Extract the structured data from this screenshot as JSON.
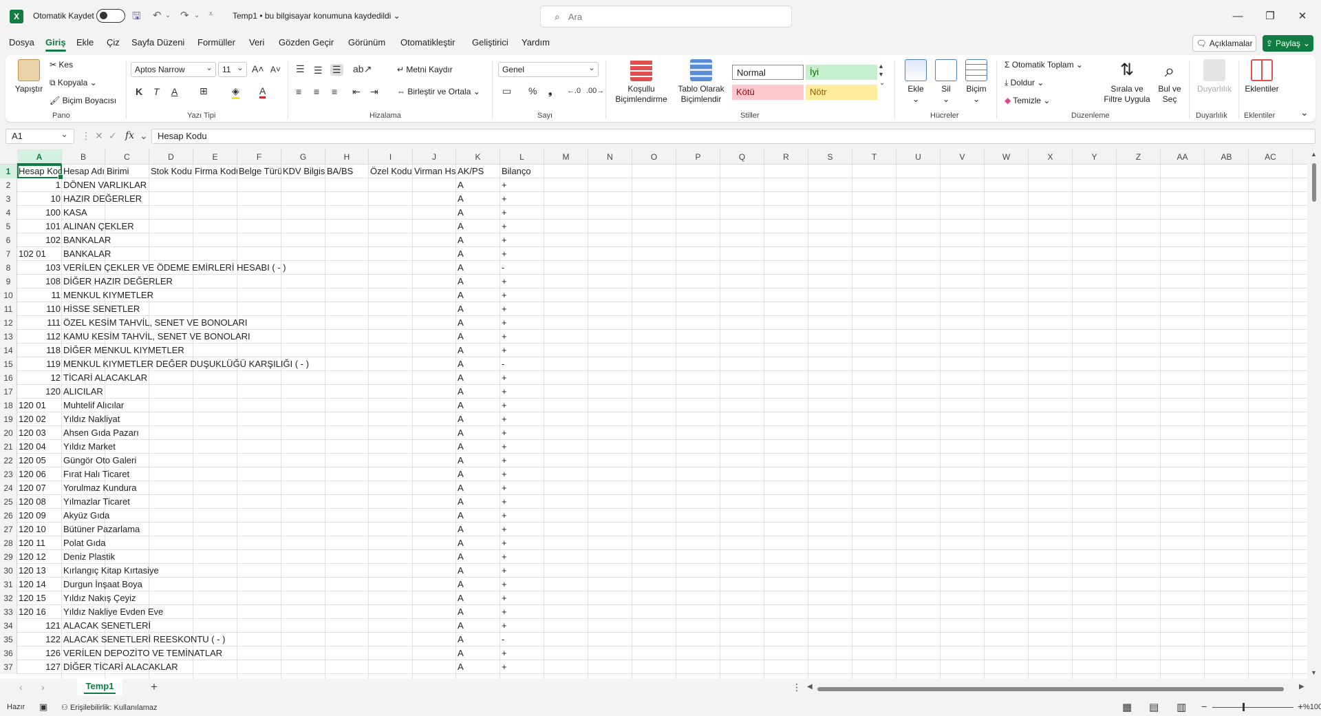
{
  "titlebar": {
    "autosave_label": "Otomatik Kaydet",
    "doc_title": "Temp1 • bu bilgisayar konumuna kaydedildi ⌄",
    "search_placeholder": "Ara"
  },
  "menu": [
    "Dosya",
    "Giriş",
    "Ekle",
    "Çiz",
    "Sayfa Düzeni",
    "Formüller",
    "Veri",
    "Gözden Geçir",
    "Görünüm",
    "Otomatikleştir",
    "Geliştirici",
    "Yardım"
  ],
  "actions": {
    "comments": "Açıklamalar",
    "share": "Paylaş"
  },
  "ribbon": {
    "pano": {
      "label": "Pano",
      "paste": "Yapıştır",
      "cut": "Kes",
      "copy": "Kopyala",
      "format_painter": "Biçim Boyacısı"
    },
    "font": {
      "label": "Yazı Tipi",
      "name": "Aptos Narrow",
      "size": "11",
      "bold": "K",
      "italic": "T",
      "underline": "A"
    },
    "alignment": {
      "label": "Hizalama",
      "wrap": "Metni Kaydır",
      "merge": "Birleştir ve Ortala"
    },
    "number": {
      "label": "Sayı",
      "format": "Genel"
    },
    "styles": {
      "label": "Stiller",
      "conditional": "Koşullu Biçimlendirme",
      "table": "Tablo Olarak Biçimlendir",
      "normal": "Normal",
      "good": "İyi",
      "bad": "Kötü",
      "neutral": "Nötr"
    },
    "cells": {
      "label": "Hücreler",
      "insert": "Ekle",
      "delete": "Sil",
      "format": "Biçim"
    },
    "editing": {
      "label": "Düzenleme",
      "autosum": "Otomatik Toplam",
      "fill": "Doldur",
      "clear": "Temizle",
      "sort": "Sırala ve Filtre Uygula",
      "find": "Bul ve Seç"
    },
    "sensitivity": {
      "label": "Duyarlılık",
      "btn": "Duyarlılık"
    },
    "addins": {
      "label": "Eklentiler",
      "btn": "Eklentiler"
    }
  },
  "formula_bar": {
    "namebox": "A1",
    "fx": "fx",
    "content": "Hesap Kodu"
  },
  "columns": [
    "A",
    "B",
    "C",
    "D",
    "E",
    "F",
    "G",
    "H",
    "I",
    "J",
    "K",
    "L",
    "M",
    "N",
    "O",
    "P",
    "Q",
    "R",
    "S",
    "T",
    "U",
    "V",
    "W",
    "X",
    "Y",
    "Z",
    "AA",
    "AB",
    "AC"
  ],
  "rows": [
    {
      "n": "1",
      "a": "Hesap Kodu",
      "b": "Hesap Adı",
      "c": "Birimi",
      "d": "Stok Kodu",
      "e": "Firma Kodu",
      "f": "Belge Türü",
      "g": "KDV Bilgisi",
      "h": "BA/BS",
      "i": "Özel Kodu",
      "j": "Virman Hs",
      "k": "AK/PS",
      "l": "Bilanço",
      "anum": false
    },
    {
      "n": "2",
      "a": "1",
      "b": "DÖNEN VARLIKLAR",
      "k": "A",
      "l": "+",
      "anum": true
    },
    {
      "n": "3",
      "a": "10",
      "b": "HAZIR DEĞERLER",
      "k": "A",
      "l": "+",
      "anum": true
    },
    {
      "n": "4",
      "a": "100",
      "b": "KASA",
      "k": "A",
      "l": "+",
      "anum": true
    },
    {
      "n": "5",
      "a": "101",
      "b": "ALINAN ÇEKLER",
      "k": "A",
      "l": "+",
      "anum": true
    },
    {
      "n": "6",
      "a": "102",
      "b": "BANKALAR",
      "k": "A",
      "l": "+",
      "anum": true
    },
    {
      "n": "7",
      "a": "102 01",
      "b": "BANKALAR",
      "k": "A",
      "l": "+",
      "anum": false
    },
    {
      "n": "8",
      "a": "103",
      "b": "VERİLEN ÇEKLER VE ÖDEME EMİRLERİ HESABI  ( - )",
      "k": "A",
      "l": "-",
      "anum": true
    },
    {
      "n": "9",
      "a": "108",
      "b": "DİĞER HAZIR DEĞERLER",
      "k": "A",
      "l": "+",
      "anum": true
    },
    {
      "n": "10",
      "a": "11",
      "b": "MENKUL KIYMETLER",
      "k": "A",
      "l": "+",
      "anum": true
    },
    {
      "n": "11",
      "a": "110",
      "b": "HİSSE SENETLER",
      "k": "A",
      "l": "+",
      "anum": true
    },
    {
      "n": "12",
      "a": "111",
      "b": "ÖZEL KESİM TAHVİL, SENET VE BONOLARI",
      "k": "A",
      "l": "+",
      "anum": true
    },
    {
      "n": "13",
      "a": "112",
      "b": "KAMU KESİM TAHVİL, SENET VE BONOLARI",
      "k": "A",
      "l": "+",
      "anum": true
    },
    {
      "n": "14",
      "a": "118",
      "b": "DİĞER MENKUL KIYMETLER",
      "k": "A",
      "l": "+",
      "anum": true
    },
    {
      "n": "15",
      "a": "119",
      "b": "MENKUL KIYMETLER DEĞER DUŞUKLÜĞÜ KARŞILIĞI ( - )",
      "k": "A",
      "l": "-",
      "anum": true
    },
    {
      "n": "16",
      "a": "12",
      "b": "TİCARİ ALACAKLAR",
      "k": "A",
      "l": "+",
      "anum": true
    },
    {
      "n": "17",
      "a": "120",
      "b": "ALICILAR",
      "k": "A",
      "l": "+",
      "anum": true
    },
    {
      "n": "18",
      "a": "120 01",
      "b": "Muhtelif Alıcılar",
      "k": "A",
      "l": "+",
      "anum": false
    },
    {
      "n": "19",
      "a": "120 02",
      "b": "Yıldız Nakliyat",
      "k": "A",
      "l": "+",
      "anum": false
    },
    {
      "n": "20",
      "a": "120 03",
      "b": "Ahsen Gıda Pazarı",
      "k": "A",
      "l": "+",
      "anum": false
    },
    {
      "n": "21",
      "a": "120 04",
      "b": "Yıldız Market",
      "k": "A",
      "l": "+",
      "anum": false
    },
    {
      "n": "22",
      "a": "120 05",
      "b": "Güngör Oto Galeri",
      "k": "A",
      "l": "+",
      "anum": false
    },
    {
      "n": "23",
      "a": "120 06",
      "b": "Fırat Halı Ticaret",
      "k": "A",
      "l": "+",
      "anum": false
    },
    {
      "n": "24",
      "a": "120 07",
      "b": "Yorulmaz Kundura",
      "k": "A",
      "l": "+",
      "anum": false
    },
    {
      "n": "25",
      "a": "120 08",
      "b": "Yılmazlar Ticaret",
      "k": "A",
      "l": "+",
      "anum": false
    },
    {
      "n": "26",
      "a": "120 09",
      "b": "Akyüz Gıda",
      "k": "A",
      "l": "+",
      "anum": false
    },
    {
      "n": "27",
      "a": "120 10",
      "b": "Bütüner Pazarlama",
      "k": "A",
      "l": "+",
      "anum": false
    },
    {
      "n": "28",
      "a": "120 11",
      "b": "Polat Gıda",
      "k": "A",
      "l": "+",
      "anum": false
    },
    {
      "n": "29",
      "a": "120 12",
      "b": "Deniz Plastik",
      "k": "A",
      "l": "+",
      "anum": false
    },
    {
      "n": "30",
      "a": "120 13",
      "b": "Kırlangıç Kitap Kırtasiye",
      "k": "A",
      "l": "+",
      "anum": false
    },
    {
      "n": "31",
      "a": "120 14",
      "b": "Durgun İnşaat Boya",
      "k": "A",
      "l": "+",
      "anum": false
    },
    {
      "n": "32",
      "a": "120 15",
      "b": "Yıldız Nakış Çeyiz",
      "k": "A",
      "l": "+",
      "anum": false
    },
    {
      "n": "33",
      "a": "120 16",
      "b": "Yıldız Nakliye Evden Eve",
      "k": "A",
      "l": "+",
      "anum": false
    },
    {
      "n": "34",
      "a": "121",
      "b": "ALACAK SENETLERİ",
      "k": "A",
      "l": "+",
      "anum": true
    },
    {
      "n": "35",
      "a": "122",
      "b": "ALACAK SENETLERİ REESKONTU ( - )",
      "k": "A",
      "l": "-",
      "anum": true
    },
    {
      "n": "36",
      "a": "126",
      "b": "VERİLEN DEPOZİTO VE TEMİNATLAR",
      "k": "A",
      "l": "+",
      "anum": true
    },
    {
      "n": "37",
      "a": "127",
      "b": "DİĞER TİCARİ ALACAKLAR",
      "k": "A",
      "l": "+",
      "anum": true
    }
  ],
  "sheet": {
    "tab": "Temp1",
    "add": "+"
  },
  "status": {
    "ready": "Hazır",
    "accessibility": "Erişilebilirlik: Kullanılamaz",
    "zoom": "%100"
  },
  "colors": {
    "accent": "#107c41",
    "good_bg": "#c6efce",
    "bad_bg": "#ffc7ce",
    "neutral_bg": "#ffeb9c"
  }
}
